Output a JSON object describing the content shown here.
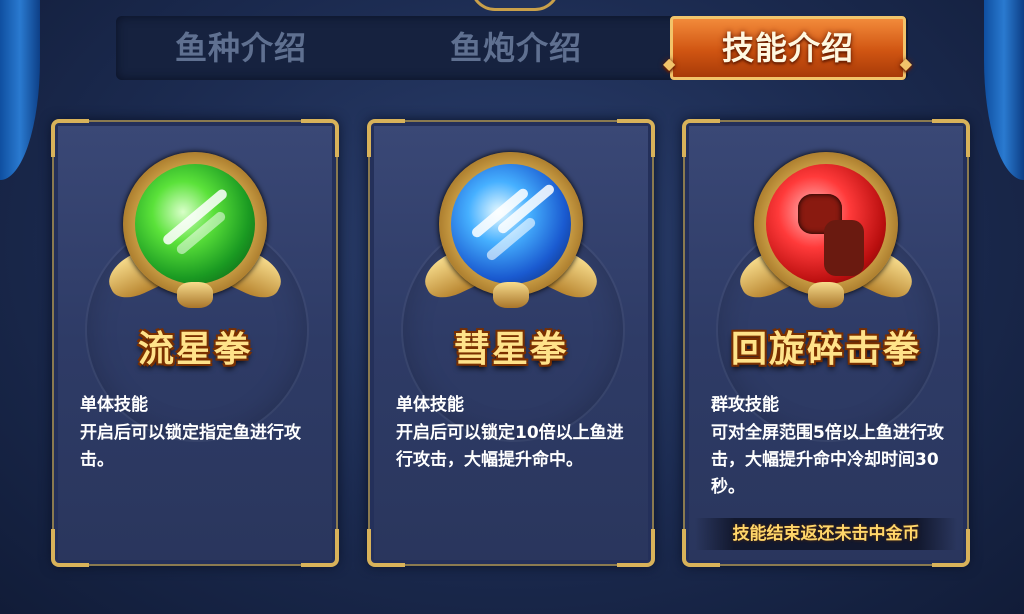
{
  "tabs": [
    {
      "label": "鱼种介绍",
      "active": false
    },
    {
      "label": "鱼炮介绍",
      "active": false
    },
    {
      "label": "技能介绍",
      "active": true
    }
  ],
  "skills": [
    {
      "name": "流星拳",
      "type": "单体技能",
      "description": "开启后可以锁定指定鱼进行攻击。",
      "icon": "green-meteor-icon",
      "color": "#3ad02a"
    },
    {
      "name": "彗星拳",
      "type": "单体技能",
      "description": "开启后可以锁定10倍以上鱼进行攻击，大幅提升命中。",
      "icon": "blue-comet-icon",
      "color": "#2a8aff"
    },
    {
      "name": "回旋碎击拳",
      "type": "群攻技能",
      "description": "可对全屏范围5倍以上鱼进行攻击，大幅提升命中冷却时间30秒。",
      "icon": "red-fist-icon",
      "color": "#e21a1a",
      "note": "技能结束返还未击中金币"
    }
  ]
}
